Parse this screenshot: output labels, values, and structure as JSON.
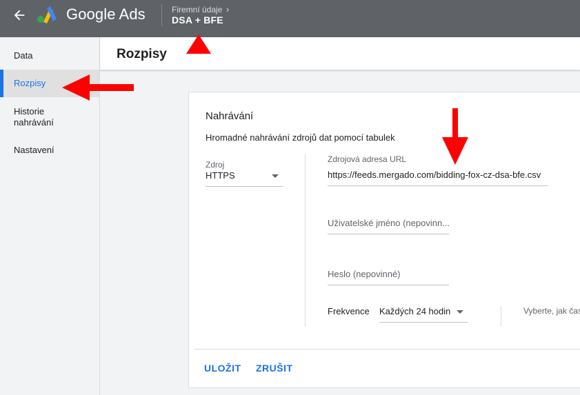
{
  "header": {
    "product_name": "Google Ads",
    "breadcrumb_label": "Firemní údaje",
    "breadcrumb_value": "DSA + BFE",
    "back_icon": "arrow-back-icon",
    "chevron_icon": "chevron-right-icon",
    "background_color": "#5f6368"
  },
  "sidenav": {
    "items": [
      {
        "label": "Data",
        "active": false
      },
      {
        "label": "Rozpisy",
        "active": true
      },
      {
        "label": "Historie nahrávání",
        "active": false
      },
      {
        "label": "Nastavení",
        "active": false
      }
    ],
    "active_color": "#1a73e8"
  },
  "page": {
    "title": "Rozpisy"
  },
  "upload": {
    "title": "Nahrávání",
    "description": "Hromadné nahrávání zdrojů dat pomocí tabulek",
    "source": {
      "label": "Zdroj",
      "value": "HTTPS"
    },
    "url": {
      "label": "Zdrojová adresa URL",
      "value": "https://feeds.mergado.com/bidding-fox-cz-dsa-bfe.csv"
    },
    "username": {
      "placeholder": "Uživatelské jméno (nepovinn..."
    },
    "password": {
      "placeholder": "Heslo (nepovinné)"
    },
    "frequency": {
      "label": "Frekvence",
      "value": "Každých 24 hodin",
      "hint": "Vyberte, jak čas"
    },
    "save_label": "ULOŽIT",
    "cancel_label": "ZRUŠIT"
  },
  "annotations": {
    "color": "#ff0000"
  }
}
